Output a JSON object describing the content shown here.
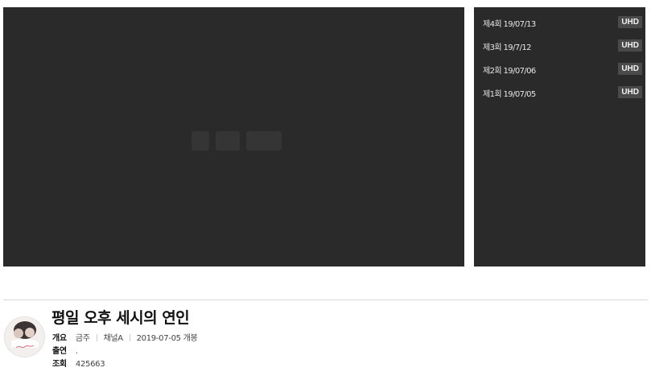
{
  "episodes": [
    {
      "label": "제4회 19/07/13",
      "quality": "UHD"
    },
    {
      "label": "제3회 19/7/12",
      "quality": "UHD"
    },
    {
      "label": "제2회 19/07/06",
      "quality": "UHD"
    },
    {
      "label": "제1회 19/07/05",
      "quality": "UHD"
    }
  ],
  "program": {
    "title": "평일 오후 세시의 연인",
    "overview_label": "개요",
    "day": "금주",
    "channel": "채널A",
    "release": "2019-07-05 개봉",
    "cast_label": "출연",
    "cast": ".",
    "views_label": "조회",
    "views": "425663"
  },
  "colors": {
    "panel_bg": "#2a2a2a",
    "badge_bg": "#4a4a4a"
  }
}
